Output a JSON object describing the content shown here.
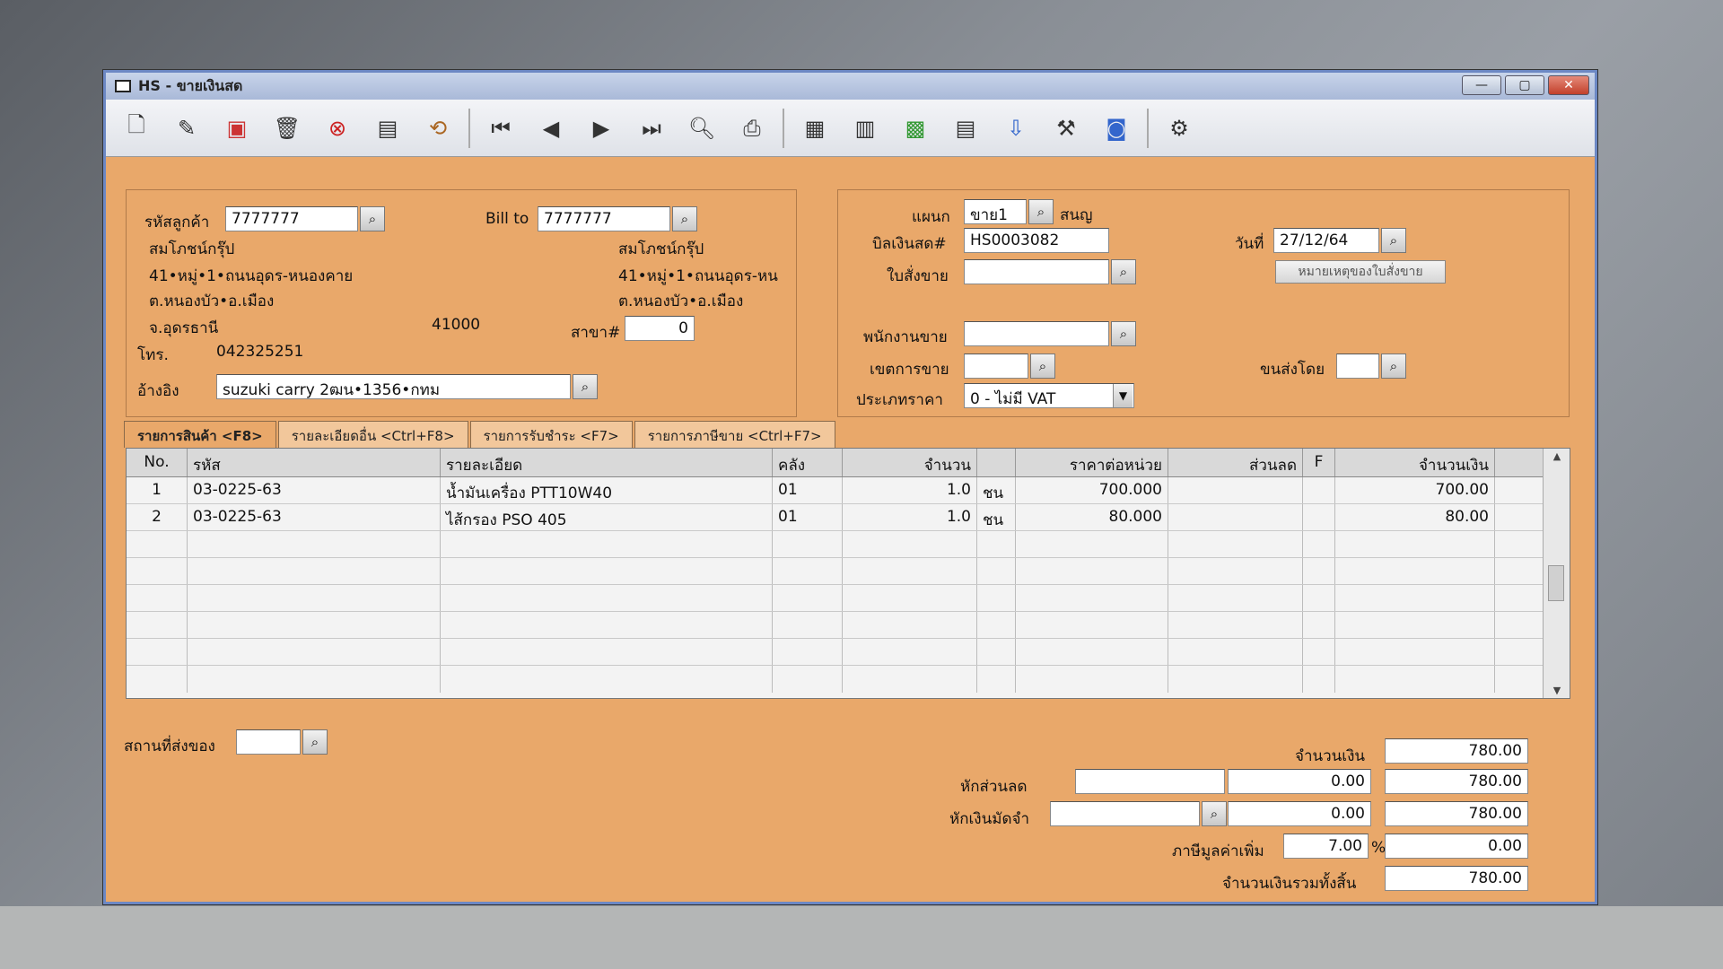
{
  "window": {
    "title": "HS - ขายเงินสด",
    "min": "—",
    "max": "▢",
    "close": "✕"
  },
  "toolbar": {
    "icons": [
      "new-doc-icon",
      "edit-icon",
      "void-icon",
      "delete-icon",
      "cancel-icon",
      "save-icon",
      "refresh-icon",
      "first-icon",
      "prev-icon",
      "next-icon",
      "last-icon",
      "preview-icon",
      "print-icon",
      "form1-icon",
      "form2-icon",
      "form3-icon",
      "calc-icon",
      "approve-icon",
      "tools-icon",
      "ok-icon",
      "settings-icon"
    ]
  },
  "customer": {
    "code_label": "รหัสลูกค้า",
    "code": "7777777",
    "name": "สมโภชน์กรุ๊ป",
    "addr1": "41•หมู่•1•ถนนอุดร-หนองคาย",
    "addr2": "ต.หนองบัว•อ.เมือง",
    "province": "จ.อุดรธานี",
    "zip": "41000",
    "phone_label": "โทร.",
    "phone": "042325251",
    "ref_label": "อ้างอิง",
    "ref": "suzuki carry 2ฒน•1356•กทม",
    "branch_label": "สาขา#",
    "branch": "0"
  },
  "billto": {
    "label": "Bill to",
    "code": "7777777",
    "name": "สมโภชน์กรุ๊ป",
    "addr1": "41•หมู่•1•ถนนอุดร-หน",
    "addr2": "ต.หนองบัว•อ.เมือง"
  },
  "doc": {
    "dept_label": "แผนก",
    "dept": "ขาย1",
    "dept_name": "สนญ",
    "bill_label": "บิลเงินสด#",
    "bill": "HS0003082",
    "order_label": "ใบสั่งขาย",
    "order": "",
    "date_label": "วันที่",
    "date": "27/12/64",
    "note_btn": "หมายเหตุของใบสั่งขาย",
    "salesman_label": "พนักงานขาย",
    "salesman": "",
    "area_label": "เขตการขาย",
    "area": "",
    "ship_label": "ขนส่งโดย",
    "ship": "",
    "pricetype_label": "ประเภทราคา",
    "pricetype": "0 - ไม่มี VAT"
  },
  "tabs": [
    "รายการสินค้า <F8>",
    "รายละเอียดอื่น <Ctrl+F8>",
    "รายการรับชำระ <F7>",
    "รายการภาษีขาย <Ctrl+F7>"
  ],
  "table": {
    "headers": [
      "No.",
      "รหัส",
      "รายละเอียด",
      "คลัง",
      "จำนวน",
      "",
      "ราคาต่อหน่วย",
      "ส่วนลด",
      "F",
      "จำนวนเงิน"
    ],
    "rows": [
      {
        "no": "1",
        "code": "03-0225-63",
        "desc": "น้ำมันเครื่อง PTT10W40",
        "wh": "01",
        "qty": "1.0",
        "unit": "ชน",
        "price": "700.000",
        "disc": "",
        "f": "",
        "amount": "700.00"
      },
      {
        "no": "2",
        "code": "03-0225-63",
        "desc": "ไส้กรอง PSO 405",
        "wh": "01",
        "qty": "1.0",
        "unit": "ชน",
        "price": "80.000",
        "disc": "",
        "f": "",
        "amount": "80.00"
      }
    ]
  },
  "footer": {
    "shipto_label": "สถานที่ส่งของ",
    "shipto": "",
    "amount_label": "จำนวนเงิน",
    "amount": "780.00",
    "discount_label": "หักส่วนลด",
    "discount_text": "",
    "discount": "0.00",
    "after_discount": "780.00",
    "deposit_label": "หักเงินมัดจำ",
    "deposit_text": "",
    "deposit": "0.00",
    "after_deposit": "780.00",
    "vat_label": "ภาษีมูลค่าเพิ่ม",
    "vat_rate": "7.00",
    "vat_pct": "%",
    "vat": "0.00",
    "total_label": "จำนวนเงินรวมทั้งสิ้น",
    "total": "780.00"
  }
}
